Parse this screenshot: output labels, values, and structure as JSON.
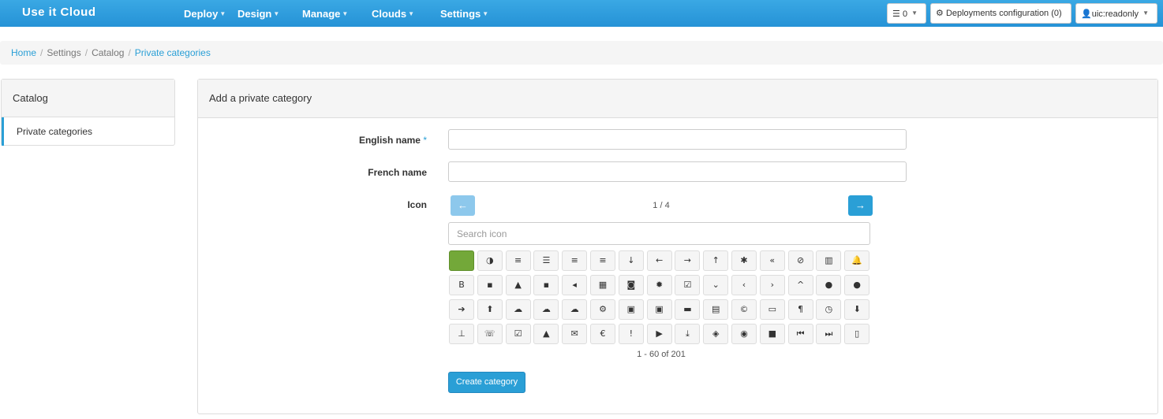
{
  "navbar": {
    "brand": "Use it Cloud",
    "menus": [
      "Deploy",
      "Design",
      "Manage",
      "Clouds",
      "Settings"
    ],
    "queue_count": "0",
    "deployments_config": "Deployments configuration (0)",
    "user": "uic:readonly",
    "brand_color": "#2a9fd6"
  },
  "breadcrumb": {
    "items": [
      "Home",
      "Settings",
      "Catalog",
      "Private categories"
    ]
  },
  "sidebar": {
    "title": "Catalog",
    "items": [
      "Private categories"
    ]
  },
  "main": {
    "title": "Add a private category",
    "english_label": "English name",
    "required_mark": "*",
    "french_label": "French name",
    "icon_label": "Icon",
    "english_value": "",
    "french_value": "",
    "page_indicator": "1 / 4",
    "search_placeholder": "Search icon",
    "range_text": "1 - 60 of 201",
    "create_label": "Create category",
    "selected_color": "#73a839",
    "icons": [
      "",
      "◑",
      "≡",
      "☰",
      "≡",
      "≡",
      "↓",
      "←",
      "→",
      "↑",
      "✱",
      "«",
      "⊘",
      "▥",
      "🔔",
      "B",
      "▪",
      "▲",
      "▪",
      "◂",
      "▦",
      "◙",
      "✹",
      "☑",
      "⌄",
      "‹",
      "›",
      "^",
      "●",
      "●",
      "➔",
      "⬆",
      "☁",
      "☁",
      "☁",
      "⚙",
      "▣",
      "▣",
      "▬",
      "▤",
      "©",
      "▭",
      "¶",
      "◷",
      "⬇",
      "⊥",
      "☏",
      "☑",
      "▲",
      "✉",
      "€",
      "!",
      "▶",
      "⤓",
      "◈",
      "◉",
      "■",
      "⏮",
      "⏭",
      "▯"
    ],
    "icon_names": [
      "adjust-icon",
      "adjust-half-icon",
      "align-center-icon",
      "align-justify-icon",
      "align-left-icon",
      "align-right-icon",
      "arrow-down-icon",
      "arrow-left-icon",
      "arrow-right-icon",
      "arrow-up-icon",
      "asterisk-icon",
      "backward-icon",
      "ban-icon",
      "barcode-icon",
      "bell-icon",
      "bold-icon",
      "book-icon",
      "bookmark-icon",
      "briefcase-icon",
      "bullhorn-icon",
      "calendar-icon",
      "camera-icon",
      "certificate-icon",
      "check-icon",
      "chevron-down-icon",
      "chevron-left-icon",
      "chevron-right-icon",
      "chevron-up-icon",
      "circle-arrow-down-icon",
      "circle-arrow-left-icon",
      "circle-arrow-right-icon",
      "circle-arrow-up-icon",
      "cloud-icon",
      "cloud-download-icon",
      "cloud-upload-icon",
      "cog-icon",
      "collapse-down-icon",
      "collapse-up-icon",
      "comment-icon",
      "compressed-icon",
      "copyright-icon",
      "credit-card-icon",
      "cutlery-icon",
      "dashboard-icon",
      "download-icon",
      "download-alt-icon",
      "earphone-icon",
      "edit-icon",
      "eject-icon",
      "envelope-icon",
      "euro-icon",
      "exclamation-icon",
      "expand-icon",
      "export-icon",
      "eye-close-icon",
      "eye-open-icon",
      "facetime-video-icon",
      "fast-backward-icon",
      "fast-forward-icon",
      "file-icon"
    ]
  }
}
